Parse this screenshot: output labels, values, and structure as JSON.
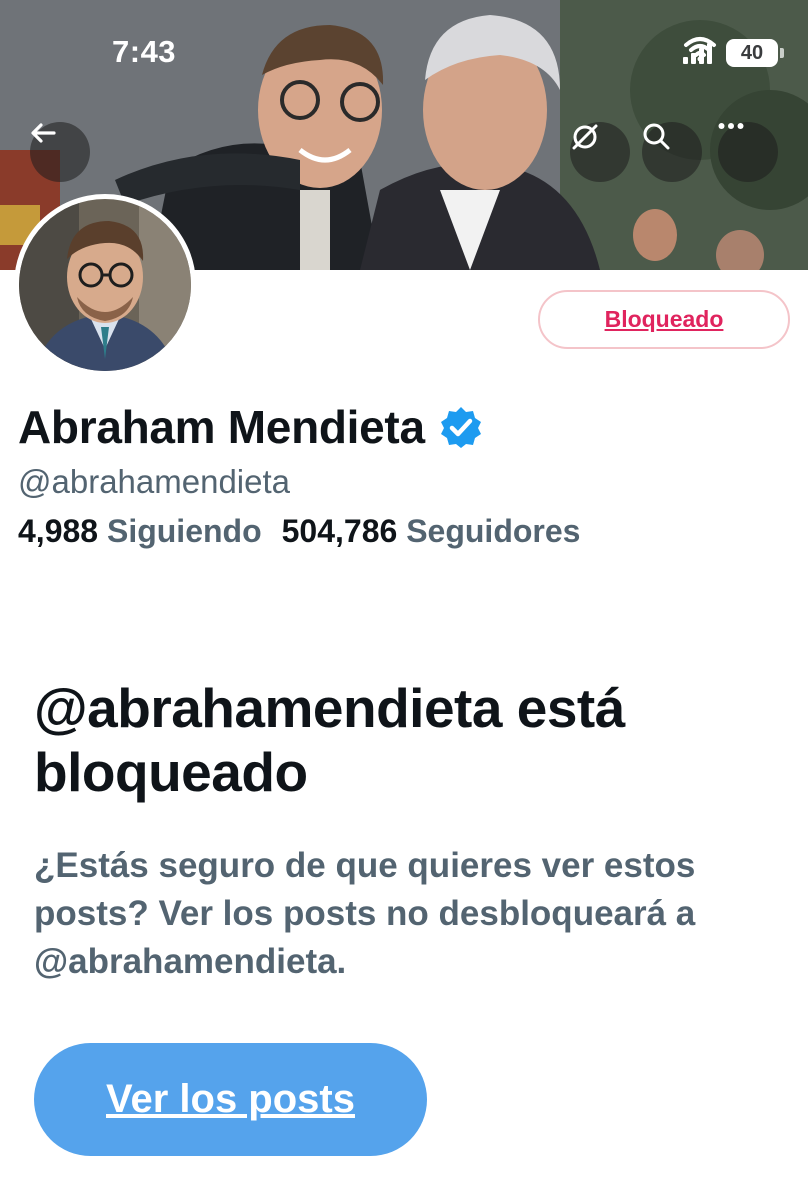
{
  "status_bar": {
    "time": "7:43",
    "battery": "40",
    "icons": [
      "signal-icon",
      "wifi-icon",
      "battery-icon"
    ]
  },
  "banner": {
    "back_icon": "back-arrow-icon",
    "hide_icon": "eye-slash-icon",
    "search_icon": "search-icon",
    "more_icon": "more-icon"
  },
  "profile": {
    "display_name": "Abraham Mendieta",
    "handle": "@abrahamendieta",
    "following_count": "4,988",
    "following_label": "Siguiendo",
    "followers_count": "504,786",
    "followers_label": "Seguidores",
    "verified_icon": "verified-badge-icon",
    "blocked_button": "Bloqueado"
  },
  "blocked_notice": {
    "title": "@abrahamendieta está bloqueado",
    "description": "¿Estás seguro de que quieres ver estos posts? Ver los posts no desbloqueará a @abrahamendieta.",
    "view_posts_button": "Ver los posts"
  },
  "colors": {
    "accent": "#55a3ec",
    "verified": "#1d9bf0",
    "blocked_red": "#e0245e",
    "secondary_text": "#536471",
    "primary_text": "#0f1419"
  }
}
